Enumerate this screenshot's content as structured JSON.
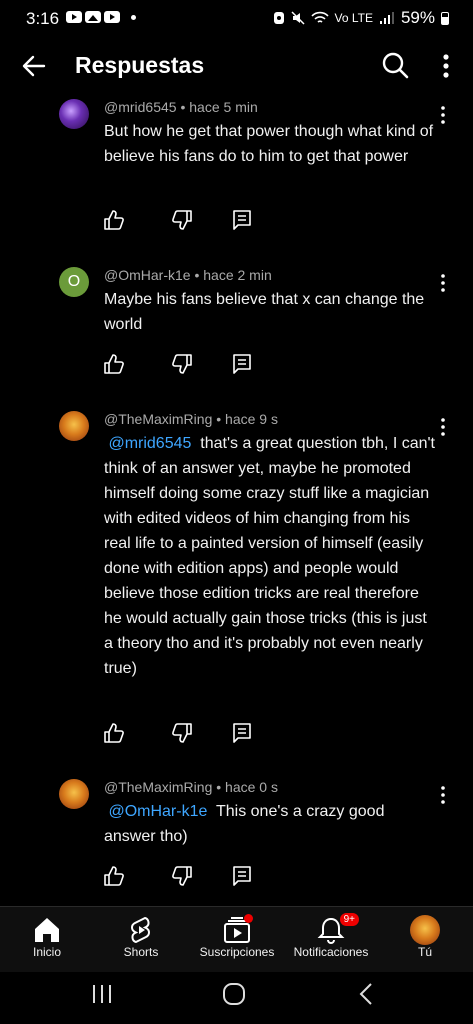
{
  "status": {
    "time": "3:16",
    "battery": "59%",
    "signal_label": "Vo LTE"
  },
  "header": {
    "title": "Respuestas"
  },
  "comments": [
    {
      "author": "@mrid6545",
      "time": "hace 5 min",
      "text": "But how he get that power though what kind of believe his fans do to him to get that power"
    },
    {
      "author": "@OmHar-k1e",
      "time": "hace 2 min",
      "avatar_letter": "O",
      "text": "Maybe his fans  believe that x can change the world"
    },
    {
      "author": "@TheMaximRing",
      "time": "hace 9 s",
      "mention": "@mrid6545",
      "text": "that's a great question tbh, I can't think of an answer yet, maybe he promoted himself doing some crazy stuff like a magician with edited videos of him changing from his real life to a painted version of himself (easily done with edition apps) and people would believe those edition tricks are real therefore he would actually gain those tricks (this is just a theory tho and it's probably not even nearly true)"
    },
    {
      "author": "@TheMaximRing",
      "time": "hace 0 s",
      "mention": "@OmHar-k1e",
      "text": "This one's a crazy good answer tho)"
    }
  ],
  "separator": " • ",
  "bottom_nav": [
    {
      "label": "Inicio",
      "icon": "home-icon"
    },
    {
      "label": "Shorts",
      "icon": "shorts-icon"
    },
    {
      "label": "Suscripciones",
      "icon": "subscriptions-icon"
    },
    {
      "label": "Notificaciones",
      "icon": "bell-icon",
      "badge": "9+"
    },
    {
      "label": "Tú",
      "icon": "avatar"
    }
  ],
  "colors": {
    "background": "#000000",
    "mention": "#3ea6ff",
    "meta": "#aaaaaa",
    "badge": "#e00000"
  }
}
